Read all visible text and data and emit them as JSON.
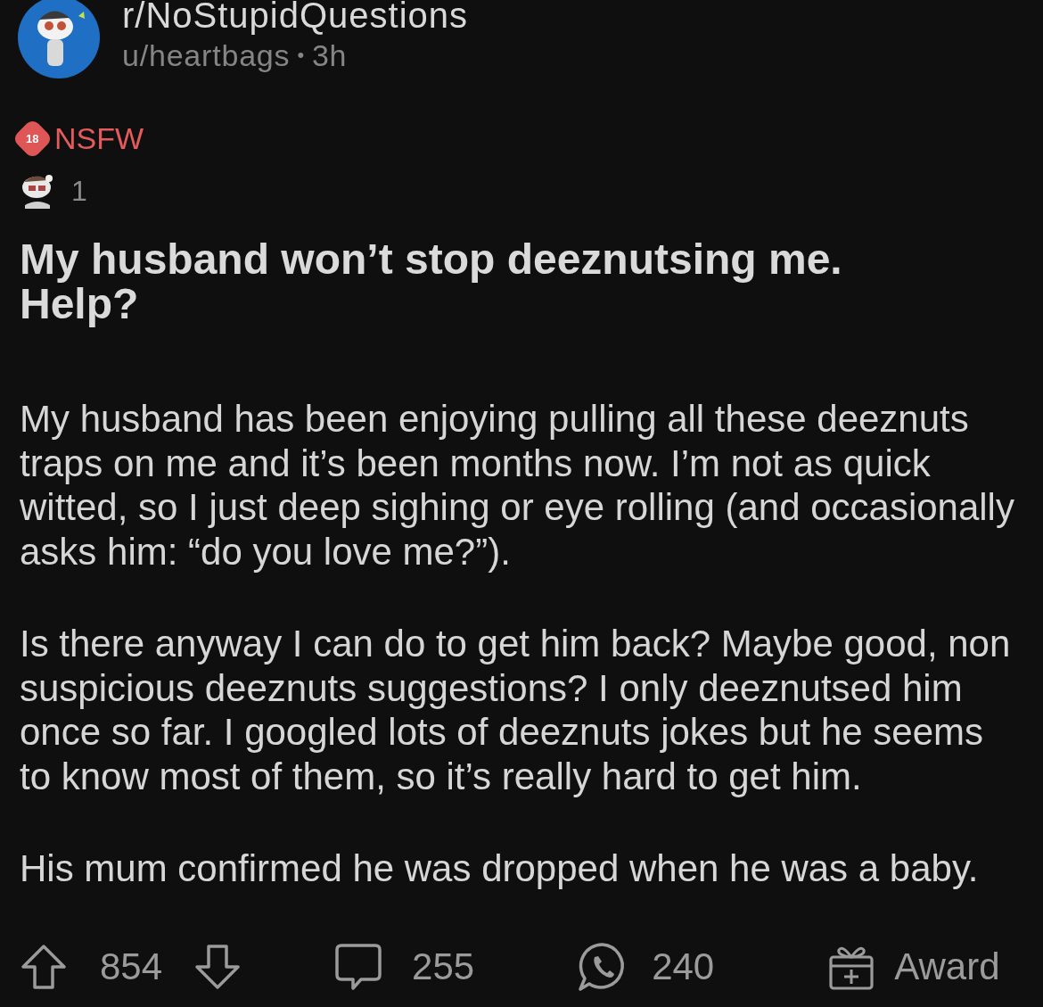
{
  "post": {
    "subreddit": "r/NoStupidQuestions",
    "author": "u/heartbags",
    "separator": "•",
    "age": "3h",
    "nsfw": {
      "badge": "18",
      "label": "NSFW"
    },
    "awards": [
      {
        "count": "1"
      }
    ],
    "title": "My husband won’t stop deeznutsing me. Help?",
    "body": [
      "My husband has been enjoying pulling all these deeznuts traps on me and it’s been months now. I’m not as quick witted, so I just deep sighing or eye rolling (and occasionally asks him: “do you love me?”).",
      "Is there anyway I can do to get him back? Maybe good, non suspicious deeznuts suggestions? I only deeznutsed him once so far. I googled lots of deeznuts jokes but he seems to know most of them, so it’s really hard to get him.",
      "His mum confirmed he was dropped when he was a baby."
    ]
  },
  "actions": {
    "score": "854",
    "comments": "255",
    "shares": "240",
    "award": "Award"
  }
}
